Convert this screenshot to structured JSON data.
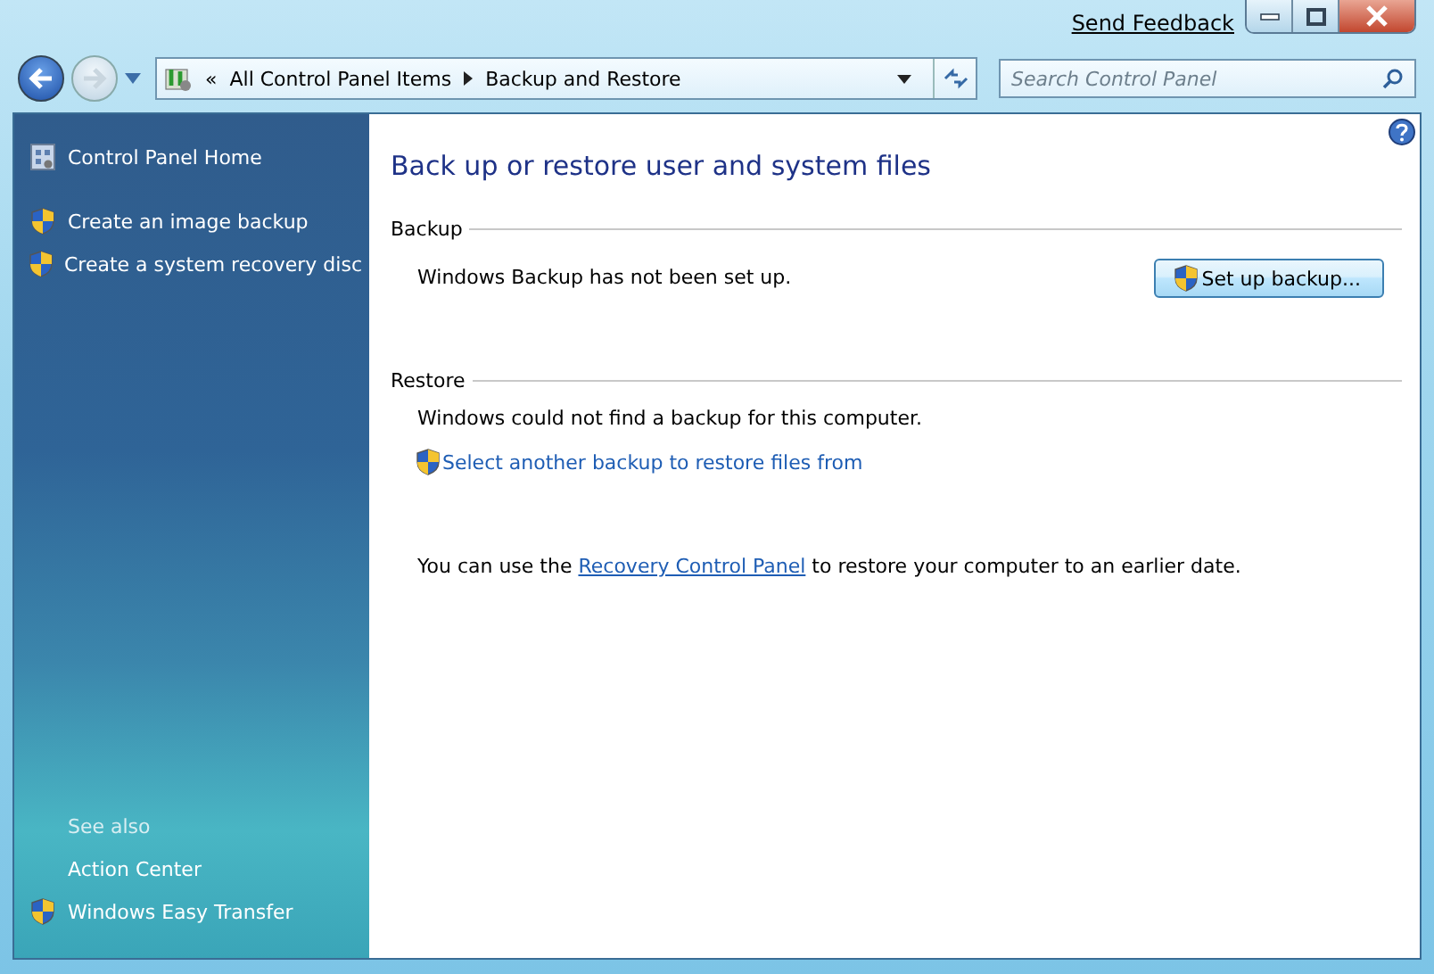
{
  "title_bar": {
    "feedback_link": "Send Feedback"
  },
  "nav": {
    "back_enabled": true,
    "forward_enabled": false
  },
  "address": {
    "overflow": "«",
    "crumbs": [
      "All Control Panel Items",
      "Backup and Restore"
    ]
  },
  "search": {
    "placeholder": "Search Control Panel"
  },
  "sidebar": {
    "items": [
      {
        "label": "Control Panel Home",
        "kind": "home"
      },
      {
        "label": "Create an image backup",
        "kind": "shield"
      },
      {
        "label": "Create a system recovery disc",
        "kind": "shield"
      }
    ],
    "see_also": {
      "heading": "See also",
      "items": [
        {
          "label": "Action Center",
          "kind": "plain"
        },
        {
          "label": "Windows Easy Transfer",
          "kind": "shield"
        }
      ]
    }
  },
  "content": {
    "title": "Back up or restore user and system files",
    "backup": {
      "heading": "Backup",
      "status": "Windows Backup has not been set up.",
      "button": "Set up backup..."
    },
    "restore": {
      "heading": "Restore",
      "status": "Windows could not find a backup for this computer.",
      "link": "Select another backup to restore files from",
      "note": {
        "before": "You can use the ",
        "link": "Recovery Control Panel",
        "after": " to restore your computer to an earlier date."
      }
    }
  }
}
